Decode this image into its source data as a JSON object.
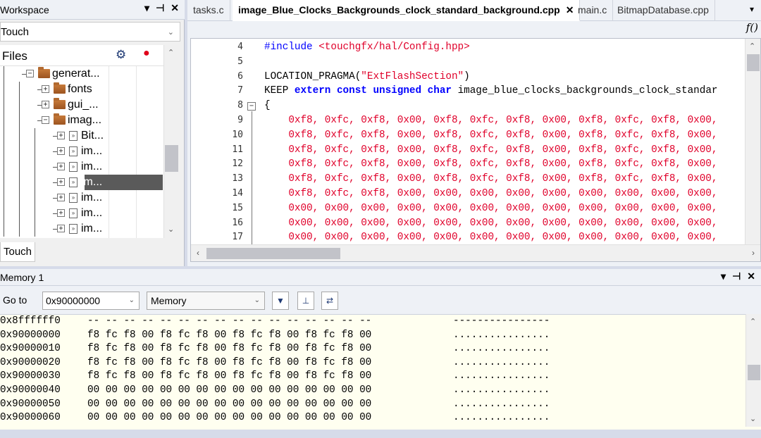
{
  "workspace": {
    "title": "Workspace",
    "controls": [
      "▾",
      "⊣",
      "✕"
    ],
    "config": "Touch",
    "files_label": "Files",
    "bottom_tab": "Touch",
    "tree": [
      {
        "label": "generat...",
        "kind": "folder",
        "toggle": "−",
        "level": 2
      },
      {
        "label": "fonts",
        "kind": "folder",
        "toggle": "+",
        "level": 3
      },
      {
        "label": "gui_...",
        "kind": "folder",
        "toggle": "+",
        "level": 3
      },
      {
        "label": "imag...",
        "kind": "folder",
        "toggle": "−",
        "level": 3
      },
      {
        "label": "Bit...",
        "kind": "file",
        "toggle": "+",
        "level": 4
      },
      {
        "label": "im...",
        "kind": "file",
        "toggle": "+",
        "level": 4
      },
      {
        "label": "im...",
        "kind": "file",
        "toggle": "+",
        "level": 4
      },
      {
        "label": "im...",
        "kind": "file",
        "toggle": "+",
        "level": 4,
        "selected": true
      },
      {
        "label": "im...",
        "kind": "file",
        "toggle": "+",
        "level": 4
      },
      {
        "label": "im...",
        "kind": "file",
        "toggle": "+",
        "level": 4
      },
      {
        "label": "im...",
        "kind": "file",
        "toggle": "+",
        "level": 4
      }
    ]
  },
  "editor": {
    "tabs": [
      {
        "label": "tasks.c",
        "active": false
      },
      {
        "label": "image_Blue_Clocks_Backgrounds_clock_standard_background.cpp",
        "active": true,
        "close": "✕"
      },
      {
        "label": "main.c",
        "active": false
      },
      {
        "label": "BitmapDatabase.cpp",
        "active": false
      }
    ],
    "tab_menu": "▾",
    "func_button": "f()",
    "fold_toggle": "−",
    "lines": [
      {
        "n": "4",
        "segs": [
          {
            "t": "#include ",
            "c": "pp"
          },
          {
            "t": "<touchgfx/hal/Config.hpp>",
            "c": "str"
          }
        ]
      },
      {
        "n": "5",
        "segs": []
      },
      {
        "n": "6",
        "segs": [
          {
            "t": "LOCATION_PRAGMA(",
            "c": ""
          },
          {
            "t": "\"ExtFlashSection\"",
            "c": "str"
          },
          {
            "t": ")",
            "c": ""
          }
        ]
      },
      {
        "n": "7",
        "segs": [
          {
            "t": "KEEP ",
            "c": ""
          },
          {
            "t": "extern const unsigned char",
            "c": "kw"
          },
          {
            "t": " image_blue_clocks_backgrounds_clock_standar",
            "c": ""
          }
        ]
      },
      {
        "n": "8",
        "segs": [
          {
            "t": "{",
            "c": ""
          }
        ]
      },
      {
        "n": "9",
        "segs": [
          {
            "t": "    0xf8, 0xfc, 0xf8, 0x00, 0xf8, 0xfc, 0xf8, 0x00, 0xf8, 0xfc, 0xf8, 0x00,",
            "c": "hex"
          }
        ]
      },
      {
        "n": "10",
        "segs": [
          {
            "t": "    0xf8, 0xfc, 0xf8, 0x00, 0xf8, 0xfc, 0xf8, 0x00, 0xf8, 0xfc, 0xf8, 0x00,",
            "c": "hex"
          }
        ]
      },
      {
        "n": "11",
        "segs": [
          {
            "t": "    0xf8, 0xfc, 0xf8, 0x00, 0xf8, 0xfc, 0xf8, 0x00, 0xf8, 0xfc, 0xf8, 0x00,",
            "c": "hex"
          }
        ]
      },
      {
        "n": "12",
        "segs": [
          {
            "t": "    0xf8, 0xfc, 0xf8, 0x00, 0xf8, 0xfc, 0xf8, 0x00, 0xf8, 0xfc, 0xf8, 0x00,",
            "c": "hex"
          }
        ]
      },
      {
        "n": "13",
        "segs": [
          {
            "t": "    0xf8, 0xfc, 0xf8, 0x00, 0xf8, 0xfc, 0xf8, 0x00, 0xf8, 0xfc, 0xf8, 0x00,",
            "c": "hex"
          }
        ]
      },
      {
        "n": "14",
        "segs": [
          {
            "t": "    0xf8, 0xfc, 0xf8, 0x00, 0x00, 0x00, 0x00, 0x00, 0x00, 0x00, 0x00, 0x00,",
            "c": "hex"
          }
        ]
      },
      {
        "n": "15",
        "segs": [
          {
            "t": "    0x00, 0x00, 0x00, 0x00, 0x00, 0x00, 0x00, 0x00, 0x00, 0x00, 0x00, 0x00,",
            "c": "hex"
          }
        ]
      },
      {
        "n": "16",
        "segs": [
          {
            "t": "    0x00, 0x00, 0x00, 0x00, 0x00, 0x00, 0x00, 0x00, 0x00, 0x00, 0x00, 0x00,",
            "c": "hex"
          }
        ]
      },
      {
        "n": "17",
        "segs": [
          {
            "t": "    0x00, 0x00, 0x00, 0x00, 0x00, 0x00, 0x00, 0x00, 0x00, 0x00, 0x00, 0x00,",
            "c": "hex"
          }
        ]
      }
    ]
  },
  "memory": {
    "title": "Memory 1",
    "controls": [
      "▾",
      "⊣",
      "✕"
    ],
    "goto_label": "Go to",
    "address": "0x90000000",
    "view": "Memory",
    "rows": [
      {
        "addr": "0x8ffffff0",
        "bytes": "-- -- -- -- -- -- -- -- -- -- -- -- -- -- -- --",
        "ascii": "----------------"
      },
      {
        "addr": "0x90000000",
        "bytes": "f8 fc f8 00 f8 fc f8 00 f8 fc f8 00 f8 fc f8 00",
        "ascii": "................"
      },
      {
        "addr": "0x90000010",
        "bytes": "f8 fc f8 00 f8 fc f8 00 f8 fc f8 00 f8 fc f8 00",
        "ascii": "................"
      },
      {
        "addr": "0x90000020",
        "bytes": "f8 fc f8 00 f8 fc f8 00 f8 fc f8 00 f8 fc f8 00",
        "ascii": "................"
      },
      {
        "addr": "0x90000030",
        "bytes": "f8 fc f8 00 f8 fc f8 00 f8 fc f8 00 f8 fc f8 00",
        "ascii": "................"
      },
      {
        "addr": "0x90000040",
        "bytes": "00 00 00 00 00 00 00 00 00 00 00 00 00 00 00 00",
        "ascii": "................"
      },
      {
        "addr": "0x90000050",
        "bytes": "00 00 00 00 00 00 00 00 00 00 00 00 00 00 00 00",
        "ascii": "................"
      },
      {
        "addr": "0x90000060",
        "bytes": "00 00 00 00 00 00 00 00 00 00 00 00 00 00 00 00",
        "ascii": "................"
      }
    ]
  },
  "colors": {
    "keyword": "#0000ff",
    "string": "#e0002a",
    "memory_bg": "#fffff0",
    "chrome_bg": "#d6dbe9"
  },
  "icons": {
    "gear": "gear-icon",
    "record": "record-dot-icon",
    "step": "step-into-icon",
    "autorefresh": "auto-refresh-icon"
  }
}
